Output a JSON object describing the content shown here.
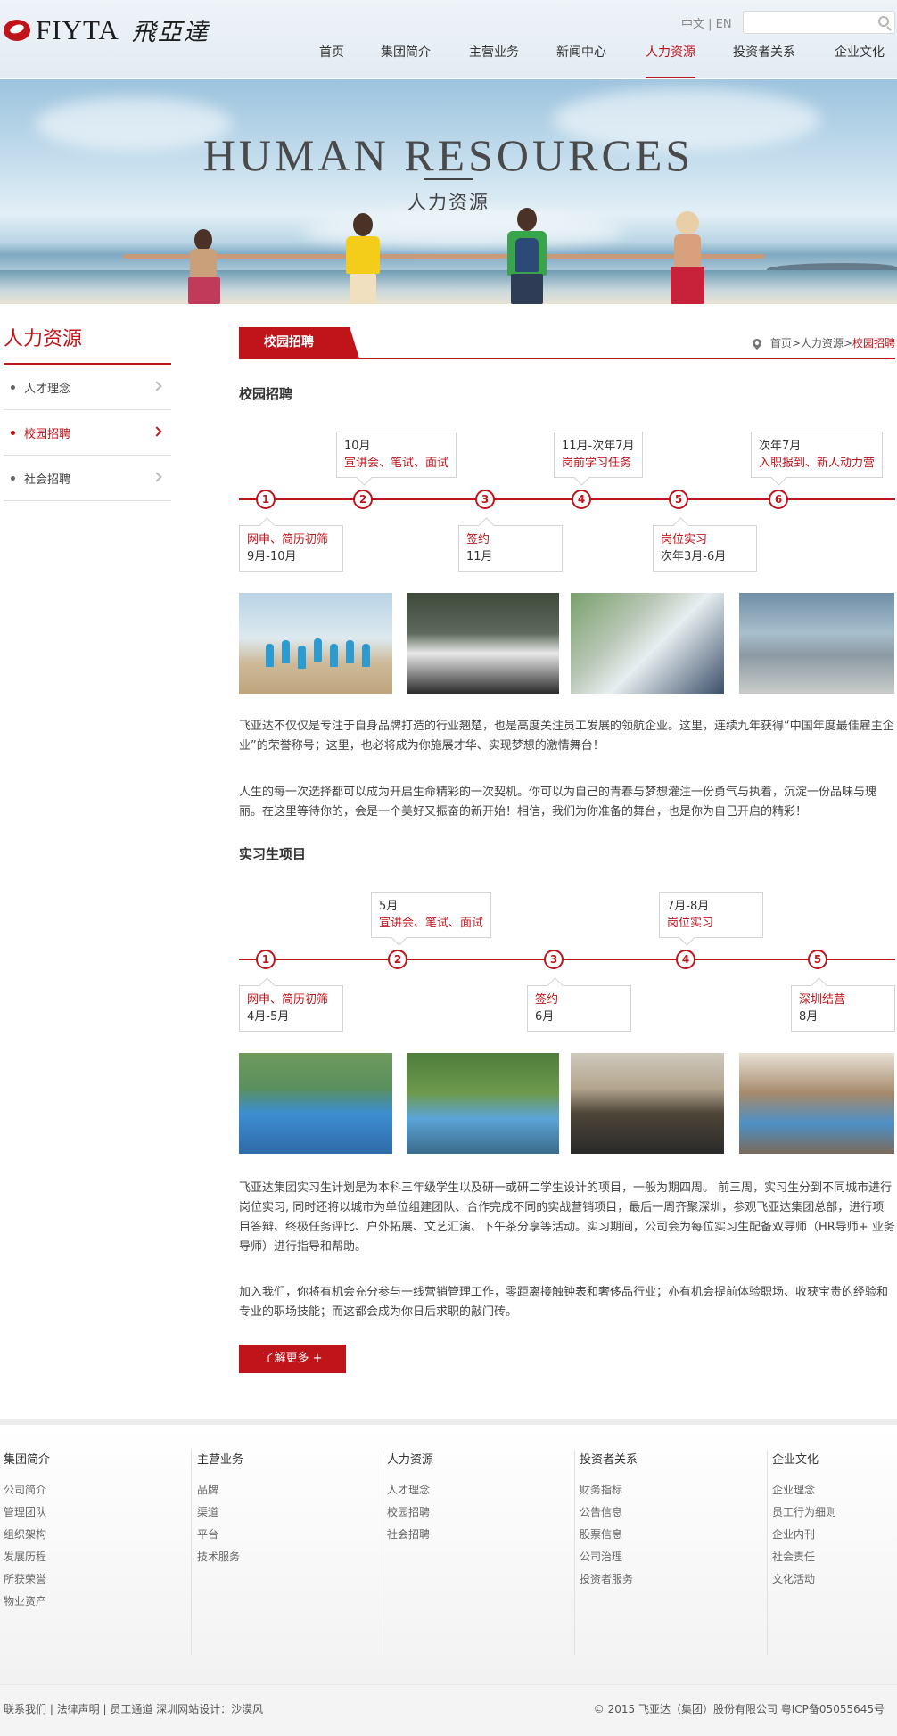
{
  "header": {
    "logo_en": "FIYTA",
    "logo_cn": "飛亞達",
    "lang_cn": "中文",
    "lang_sep": " | ",
    "lang_en": "EN",
    "search_placeholder": "",
    "nav": [
      "首页",
      "集团简介",
      "主营业务",
      "新闻中心",
      "人力资源",
      "投资者关系",
      "企业文化"
    ],
    "active_nav": "人力资源"
  },
  "banner": {
    "title": "HUMAN RESOURCES",
    "subtitle": "人力资源"
  },
  "sidebar": {
    "title": "人力资源",
    "items": [
      {
        "label": "人才理念",
        "active": false
      },
      {
        "label": "校园招聘",
        "active": true
      },
      {
        "label": "社会招聘",
        "active": false
      }
    ]
  },
  "content": {
    "tab": "校园招聘",
    "breadcrumb": {
      "home": "首页",
      "sep1": " > ",
      "parent": "人力资源",
      "sep2": " > ",
      "current": "校园招聘"
    },
    "campus": {
      "title": "校园招聘",
      "nodes": [
        "1",
        "2",
        "3",
        "4",
        "5",
        "6"
      ],
      "boxes_up": [
        {
          "l1": "10月",
          "l2": "宣讲会、笔试、面试"
        },
        {
          "l1": "11月-次年7月",
          "l2": "岗前学习任务"
        },
        {
          "l1": "次年7月",
          "l2": "入职报到、新人动力营"
        }
      ],
      "boxes_down": [
        {
          "l1": "网申、简历初筛",
          "l2": "9月-10月"
        },
        {
          "l1": "签约",
          "l2": "11月"
        },
        {
          "l1": "岗位实习",
          "l2": "次年3月-6月"
        }
      ],
      "para1": "飞亚达不仅仅是专注于自身品牌打造的行业翘楚，也是高度关注员工发展的领航企业。这里，连续九年获得“中国年度最佳雇主企业”的荣誉称号；这里，也必将成为你施展才华、实现梦想的激情舞台！",
      "para2": "人生的每一次选择都可以成为开启生命精彩的一次契机。你可以为自己的青春与梦想灌注一份勇气与执着，沉淀一份品味与瑰丽。在这里等待你的，会是一个美好又振奋的新开始！相信，我们为你准备的舞台，也是你为自己开启的精彩！"
    },
    "intern": {
      "title": "实习生项目",
      "nodes": [
        "1",
        "2",
        "3",
        "4",
        "5"
      ],
      "boxes_up": [
        {
          "l1": "5月",
          "l2": "宣讲会、笔试、面试"
        },
        {
          "l1": "7月-8月",
          "l2": "岗位实习"
        }
      ],
      "boxes_down": [
        {
          "l1": "网申、简历初筛",
          "l2": "4月-5月"
        },
        {
          "l1": "签约",
          "l2": "6月"
        },
        {
          "l1": "深圳结营",
          "l2": "8月"
        }
      ],
      "para1": "飞亚达集团实习生计划是为本科三年级学生以及研一或研二学生设计的项目，一般为期四周。 前三周，实习生分到不同城市进行岗位实习, 同时还将以城市为单位组建团队、合作完成不同的实战营销项目，最后一周齐聚深圳，参观飞亚达集团总部，进行项目答辩、终极任务评比、户外拓展、文艺汇演、下午茶分享等活动。实习期间，公司会为每位实习生配备双导师（HR导师+ 业务导师）进行指导和帮助。",
      "para2": "加入我们，你将有机会充分参与一线营销管理工作，零距离接触钟表和奢侈品行业；亦有机会提前体验职场、收获宝贵的经验和专业的职场技能；而这都会成为你日后求职的敲门砖。"
    },
    "more_button": "了解更多 +"
  },
  "footer": {
    "columns": [
      {
        "title": "集团简介",
        "items": [
          "公司简介",
          "管理团队",
          "组织架构",
          "发展历程",
          "所获荣誉",
          "物业资产"
        ]
      },
      {
        "title": "主营业务",
        "items": [
          "品牌",
          "渠道",
          "平台",
          "技术服务"
        ]
      },
      {
        "title": "人力资源",
        "items": [
          "人才理念",
          "校园招聘",
          "社会招聘"
        ]
      },
      {
        "title": "投资者关系",
        "items": [
          "财务指标",
          "公告信息",
          "股票信息",
          "公司治理",
          "投资者服务"
        ]
      },
      {
        "title": "企业文化",
        "items": [
          "企业理念",
          "员工行为细则",
          "企业内刊",
          "社会责任",
          "文化活动"
        ]
      }
    ],
    "bottom_left": "联系我们 | 法律声明 | 员工通道 深圳网站设计：沙漠风",
    "bottom_right": "© 2015 飞亚达（集团）股份有限公司    粤ICP备05055645号"
  },
  "colors": {
    "accent": "#c0141b",
    "text": "#333333"
  }
}
